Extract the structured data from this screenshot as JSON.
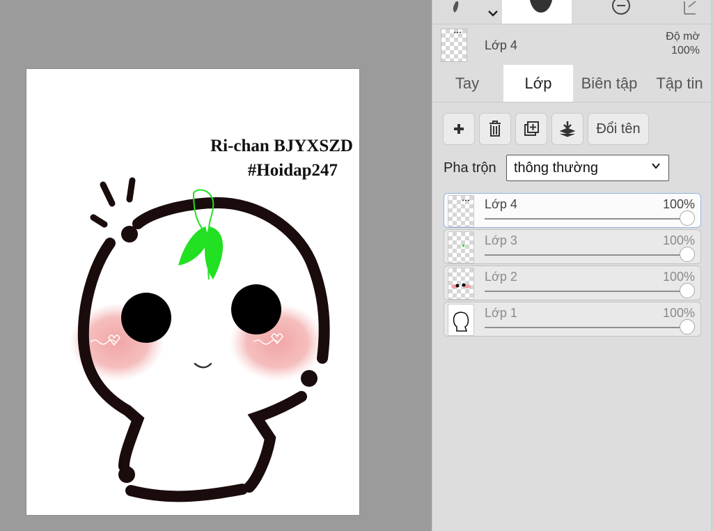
{
  "artwork": {
    "title_line1": "Ri-chan BJYXSZD",
    "title_line2": "#Hoidap247"
  },
  "toolbar": {
    "icons": [
      "pen-icon",
      "chevron-down-icon",
      "hand-icon",
      "minus-circle-icon",
      "export-icon"
    ]
  },
  "current_layer": {
    "name": "Lớp 4",
    "opacity_label": "Độ mờ",
    "opacity_value": "100%"
  },
  "tabs": [
    {
      "label": "Tay",
      "active": false
    },
    {
      "label": "Lớp",
      "active": true
    },
    {
      "label": "Biên tập",
      "active": false
    },
    {
      "label": "Tập tin",
      "active": false
    }
  ],
  "layer_actions": {
    "add_icon": "plus-icon",
    "delete_icon": "trash-icon",
    "duplicate_icon": "duplicate-icon",
    "merge_icon": "merge-down-icon",
    "rename_label": "Đổi tên"
  },
  "blend": {
    "label": "Pha trộn",
    "value": "thông thường"
  },
  "layers": [
    {
      "name": "Lớp 4",
      "opacity": "100%",
      "active": true
    },
    {
      "name": "Lớp 3",
      "opacity": "100%",
      "active": false
    },
    {
      "name": "Lớp 2",
      "opacity": "100%",
      "active": false
    },
    {
      "name": "Lớp 1",
      "opacity": "100%",
      "active": false
    }
  ],
  "colors": {
    "panel_bg": "#dddddd",
    "workspace_bg": "#9b9b9b",
    "outline": "#1a0c0c",
    "leaf": "#22e022",
    "blush": "#f0a4a4"
  }
}
